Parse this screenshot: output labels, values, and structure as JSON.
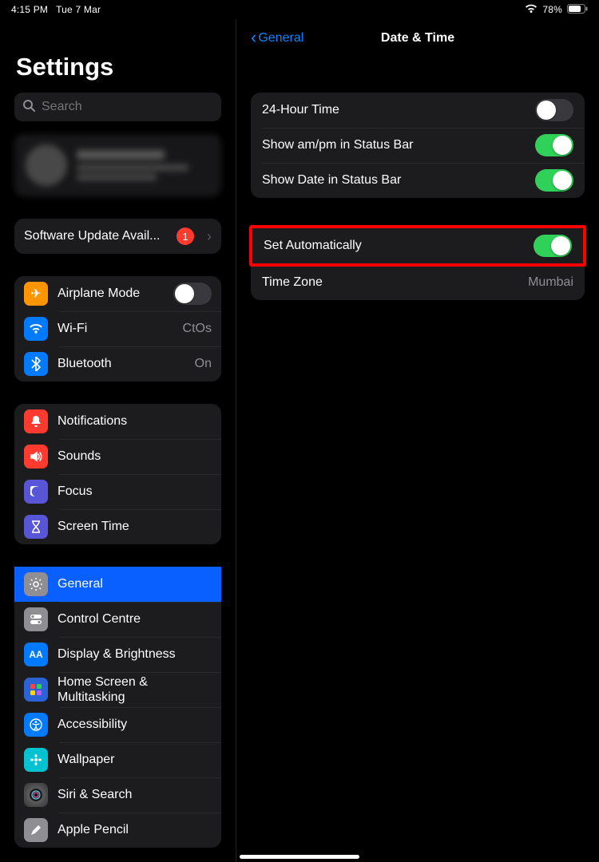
{
  "status": {
    "time": "4:15 PM",
    "date": "Tue 7 Mar",
    "battery": "78%"
  },
  "sidebar": {
    "title": "Settings",
    "search_placeholder": "Search",
    "update_row": {
      "label": "Software Update Avail...",
      "badge": "1"
    },
    "group_connect": {
      "airplane": "Airplane Mode",
      "wifi": "Wi-Fi",
      "wifi_value": "CtOs",
      "bluetooth": "Bluetooth",
      "bluetooth_value": "On"
    },
    "group_alerts": {
      "notifications": "Notifications",
      "sounds": "Sounds",
      "focus": "Focus",
      "screentime": "Screen Time"
    },
    "group_general": {
      "general": "General",
      "control": "Control Centre",
      "display": "Display & Brightness",
      "home": "Home Screen & Multitasking",
      "access": "Accessibility",
      "wallpaper": "Wallpaper",
      "siri": "Siri & Search",
      "pencil": "Apple Pencil"
    }
  },
  "detail": {
    "back_label": "General",
    "title": "Date & Time",
    "group1": {
      "twentyfour": "24-Hour Time",
      "ampm": "Show am/pm in Status Bar",
      "showdate": "Show Date in Status Bar"
    },
    "group2": {
      "setauto": "Set Automatically",
      "timezone": "Time Zone",
      "timezone_value": "Mumbai"
    }
  }
}
